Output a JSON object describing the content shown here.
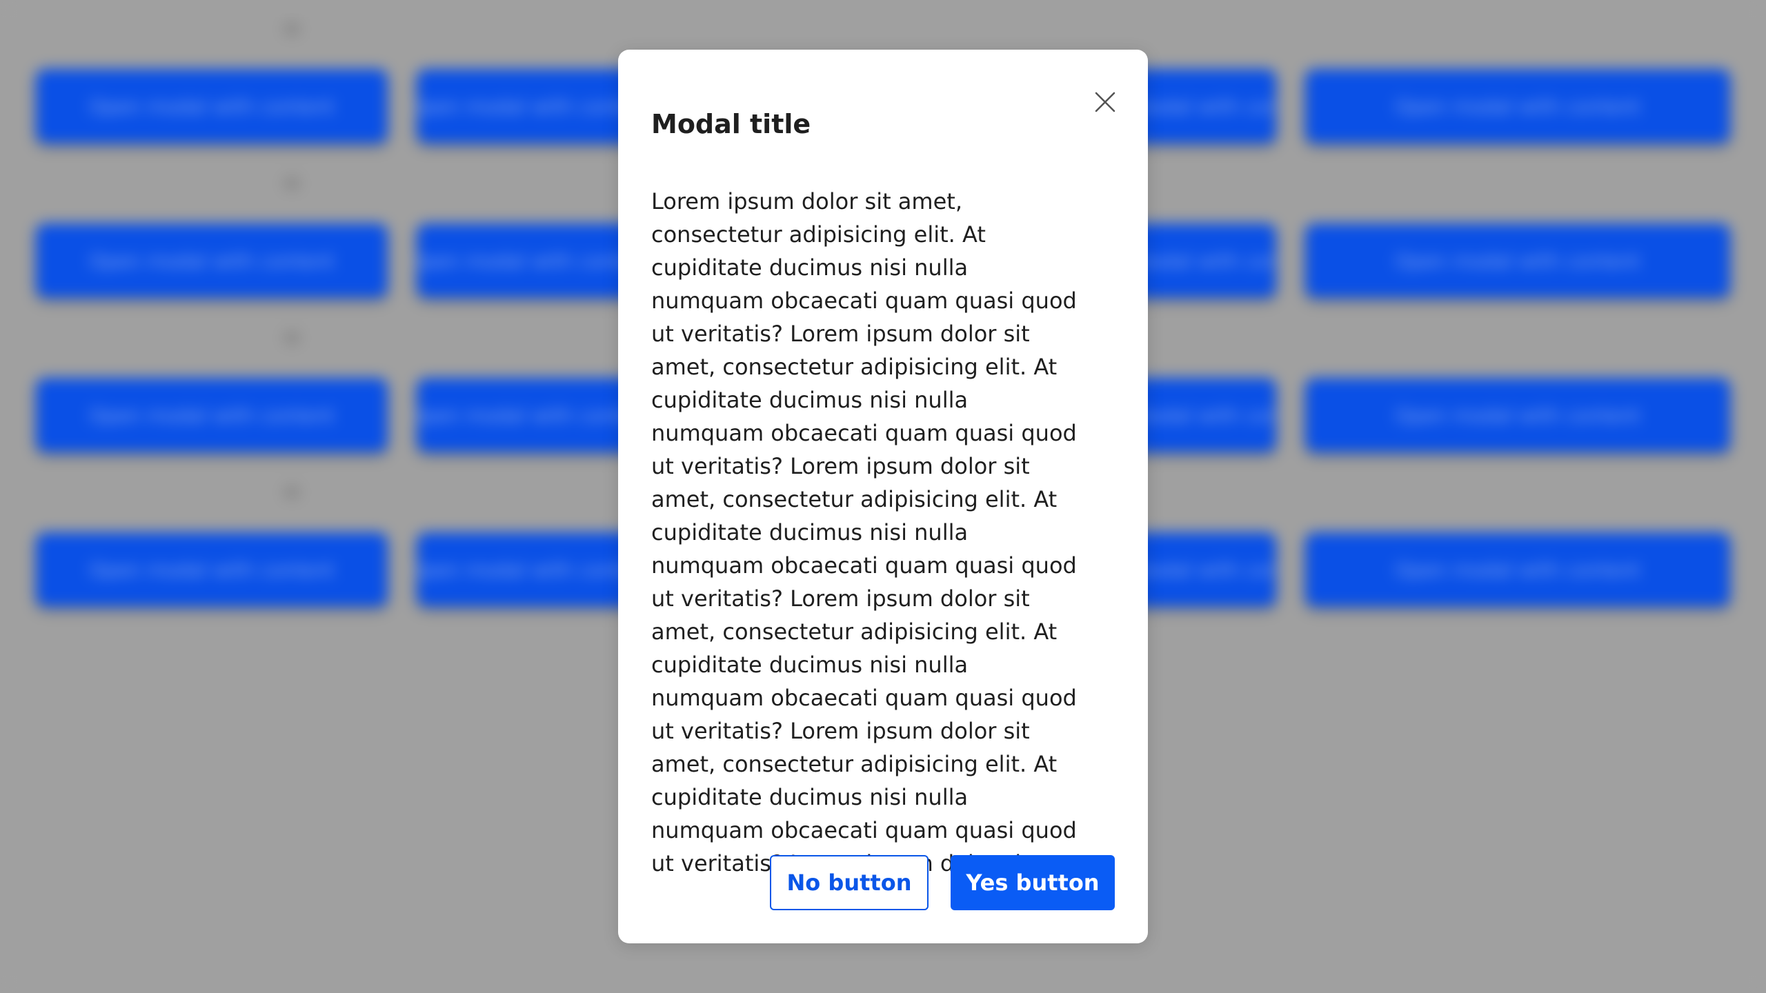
{
  "background": {
    "rows": 4,
    "button_label": "Open modal with content",
    "button_color": "#0a50e6"
  },
  "modal": {
    "title": "Modal title",
    "close_icon": "close-icon",
    "body_text": "Lorem ipsum dolor sit amet, consectetur adipisicing elit. At cupiditate ducimus nisi nulla numquam obcaecati quam quasi quod ut veritatis? Lorem ipsum dolor sit amet, consectetur adipisicing elit. At cupiditate ducimus nisi nulla numquam obcaecati quam quasi quod ut veritatis? Lorem ipsum dolor sit amet, consectetur adipisicing elit. At cupiditate ducimus nisi nulla numquam obcaecati quam quasi quod ut veritatis? Lorem ipsum dolor sit amet, consectetur adipisicing elit. At cupiditate ducimus nisi nulla numquam obcaecati quam quasi quod ut veritatis? Lorem ipsum dolor sit amet, consectetur adipisicing elit. At cupiditate ducimus nisi nulla numquam obcaecati quam quasi quod ut veritatis? Lorem ipsum dolor sit amet, consectetur adipisicing elit. At cupiditate ducimus nisi nulla numquam obcaecati",
    "no_button_label": "No button",
    "yes_button_label": "Yes button",
    "accent_color": "#0a5cf5"
  }
}
